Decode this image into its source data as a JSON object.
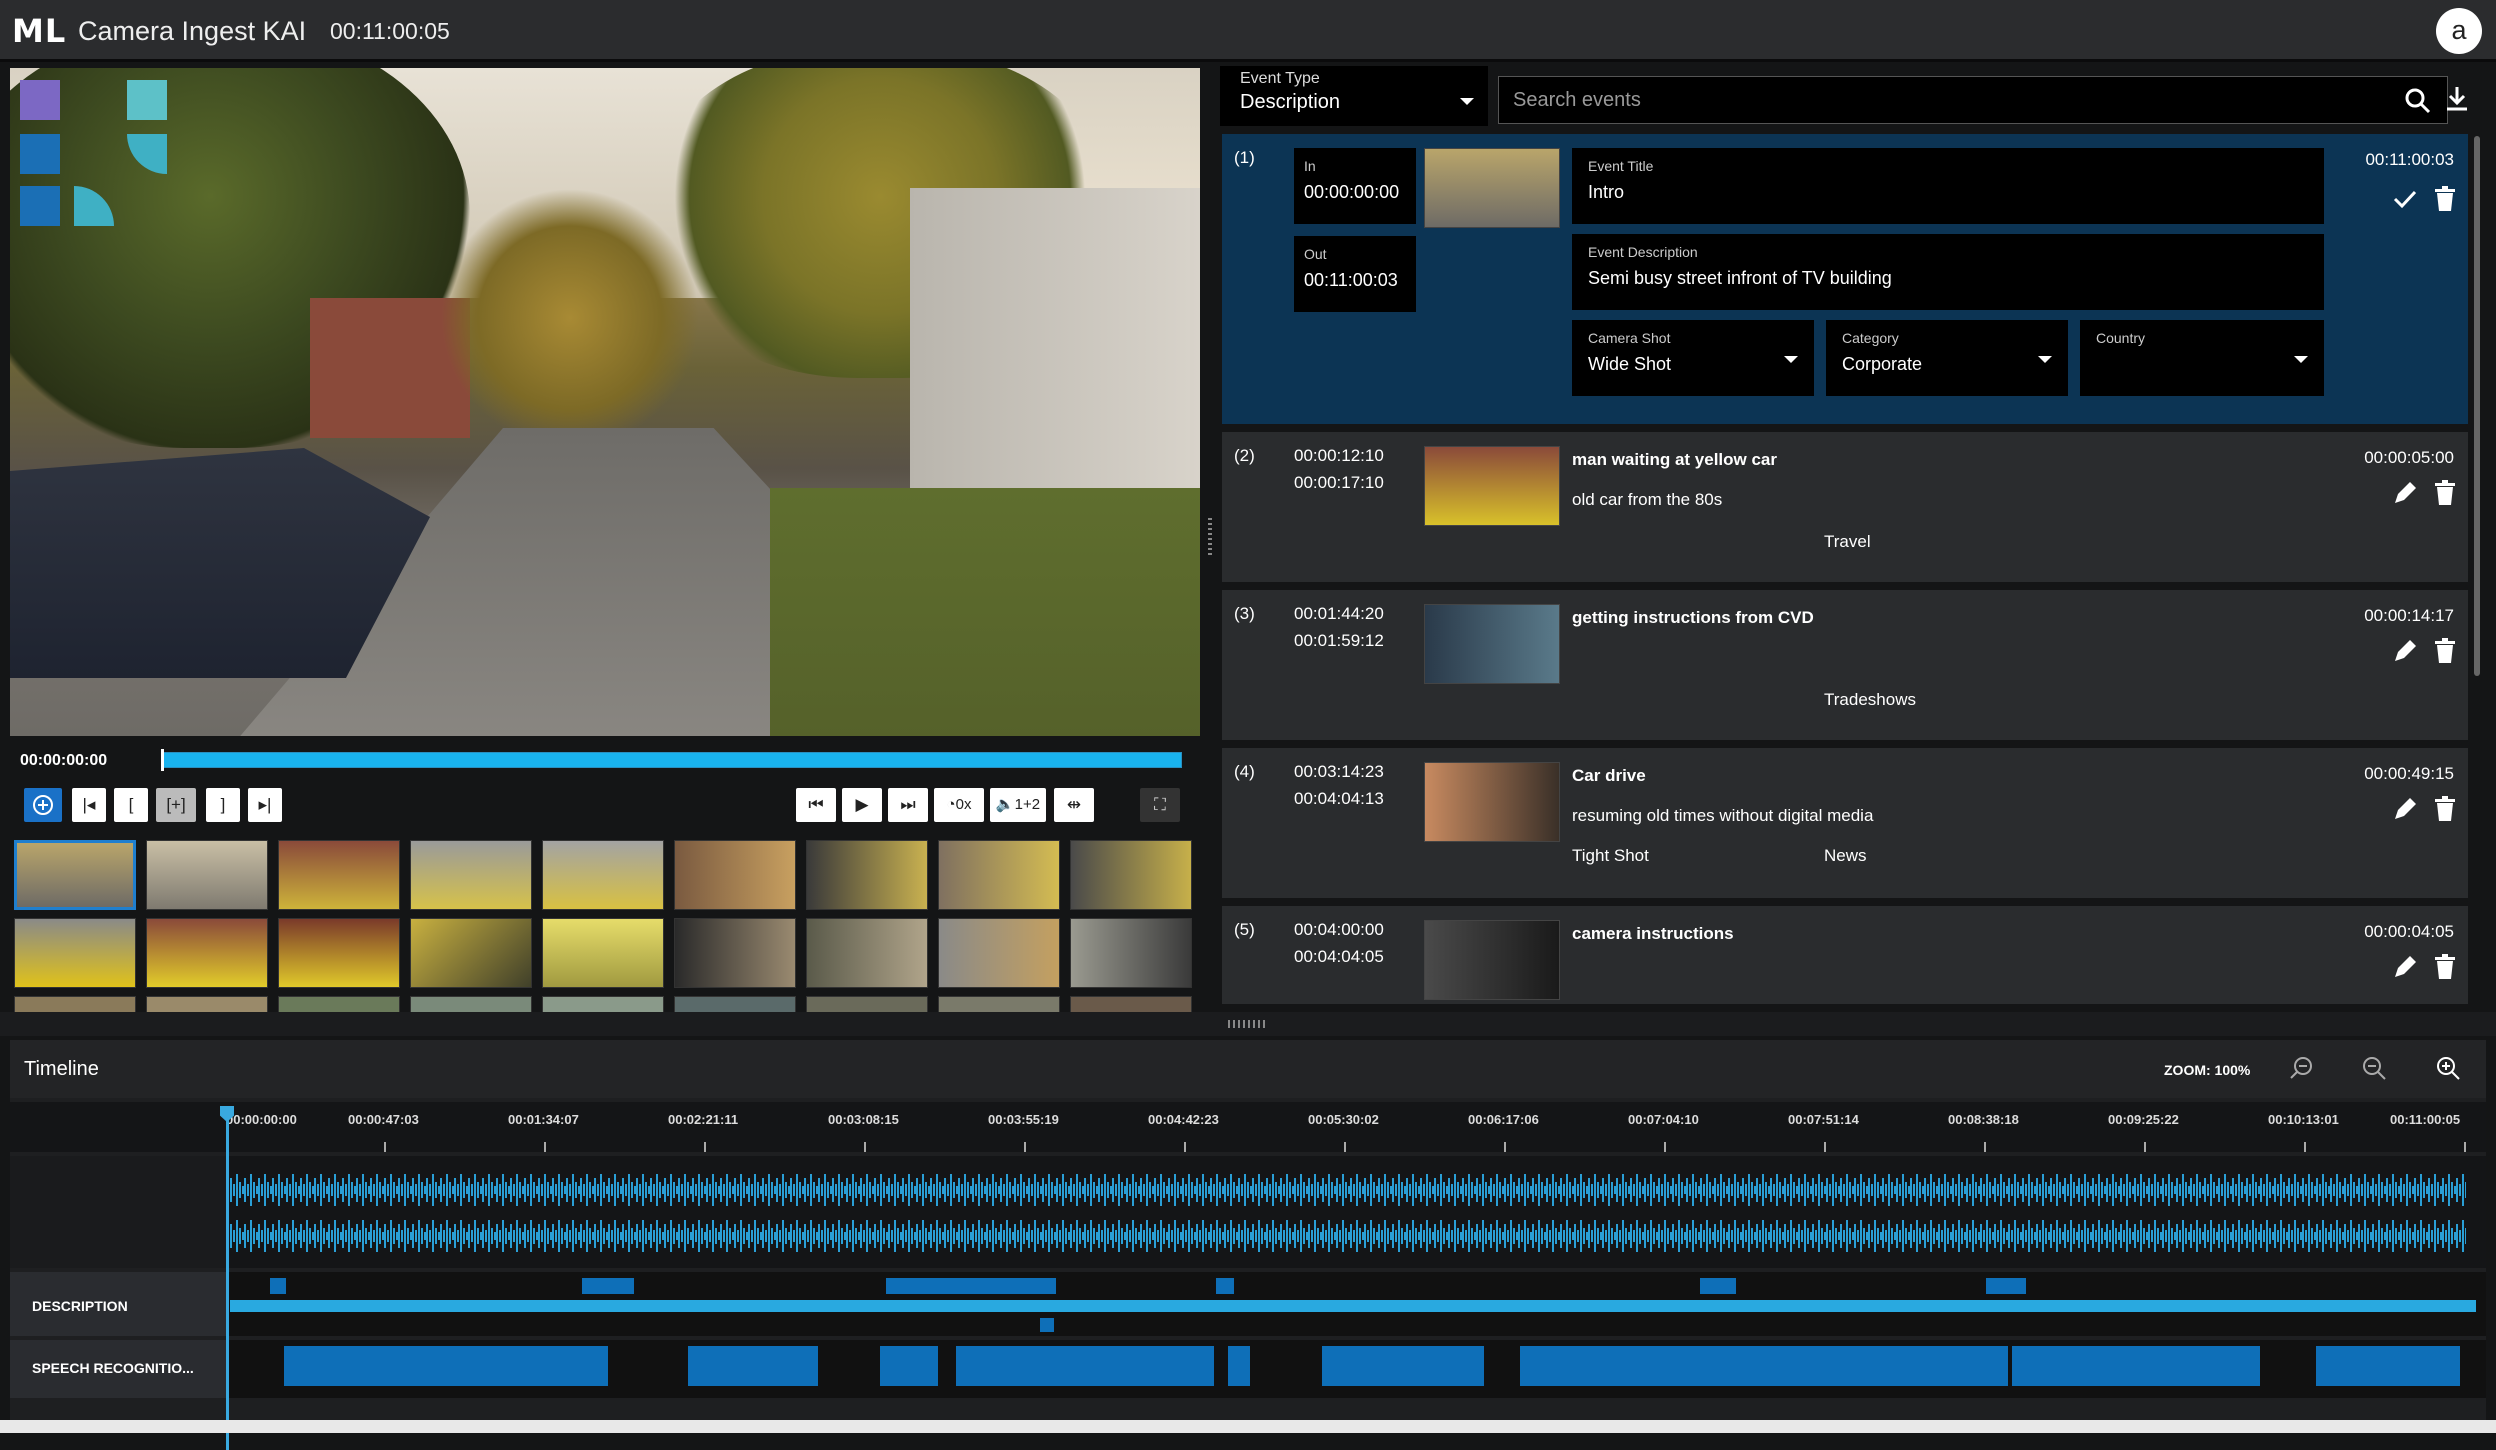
{
  "header": {
    "logo": "ML",
    "title": "Camera Ingest KAI",
    "time": "00:11:00:05",
    "avatar": "a"
  },
  "player": {
    "current_time": "00:00:00:00",
    "progress": 0.0,
    "controls": {
      "speed_label": "0x",
      "audio_label": "1+2"
    }
  },
  "filters": {
    "event_type_label": "Event Type",
    "event_type_value": "Description",
    "search_placeholder": "Search events"
  },
  "events": [
    {
      "num": "(1)",
      "in_label": "In",
      "in": "00:00:00:00",
      "out_label": "Out",
      "out": "00:11:00:03",
      "title_label": "Event Title",
      "title": "Intro",
      "desc_label": "Event Description",
      "desc": "Semi busy street infront of TV building",
      "shot_label": "Camera Shot",
      "shot": "Wide Shot",
      "cat_label": "Category",
      "cat": "Corporate",
      "country_label": "Country",
      "country": "",
      "duration": "00:11:00:03"
    },
    {
      "num": "(2)",
      "in": "00:00:12:10",
      "out": "00:00:17:10",
      "title": "man waiting at yellow car",
      "desc": "old car from the 80s",
      "shot": "",
      "cat": "Travel",
      "duration": "00:00:05:00"
    },
    {
      "num": "(3)",
      "in": "00:01:44:20",
      "out": "00:01:59:12",
      "title": "getting instructions from CVD",
      "desc": "",
      "shot": "",
      "cat": "Tradeshows",
      "duration": "00:00:14:17"
    },
    {
      "num": "(4)",
      "in": "00:03:14:23",
      "out": "00:04:04:13",
      "title": "Car drive",
      "desc": "resuming old times without digital media",
      "shot": "Tight Shot",
      "cat": "News",
      "duration": "00:00:49:15"
    },
    {
      "num": "(5)",
      "in": "00:04:00:00",
      "out": "00:04:04:05",
      "title": "camera instructions",
      "desc": "",
      "shot": "",
      "cat": "",
      "duration": "00:00:04:05"
    }
  ],
  "timeline": {
    "title": "Timeline",
    "zoom": "ZOOM: 100%",
    "ticks": [
      "00:00:00:00",
      "00:00:47:03",
      "00:01:34:07",
      "00:02:21:11",
      "00:03:08:15",
      "00:03:55:19",
      "00:04:42:23",
      "00:05:30:02",
      "00:06:17:06",
      "00:07:04:10",
      "00:07:51:14",
      "00:08:38:18",
      "00:09:25:22",
      "00:10:13:01",
      "00:11:00:05"
    ],
    "tracks": {
      "description": "DESCRIPTION",
      "speech": "SPEECH RECOGNITIO..."
    }
  },
  "colors": {
    "accent": "#1a71c7",
    "waveform": "#2a9fd6",
    "active_event": "#0c3454",
    "segment": "#0e6fb8"
  }
}
